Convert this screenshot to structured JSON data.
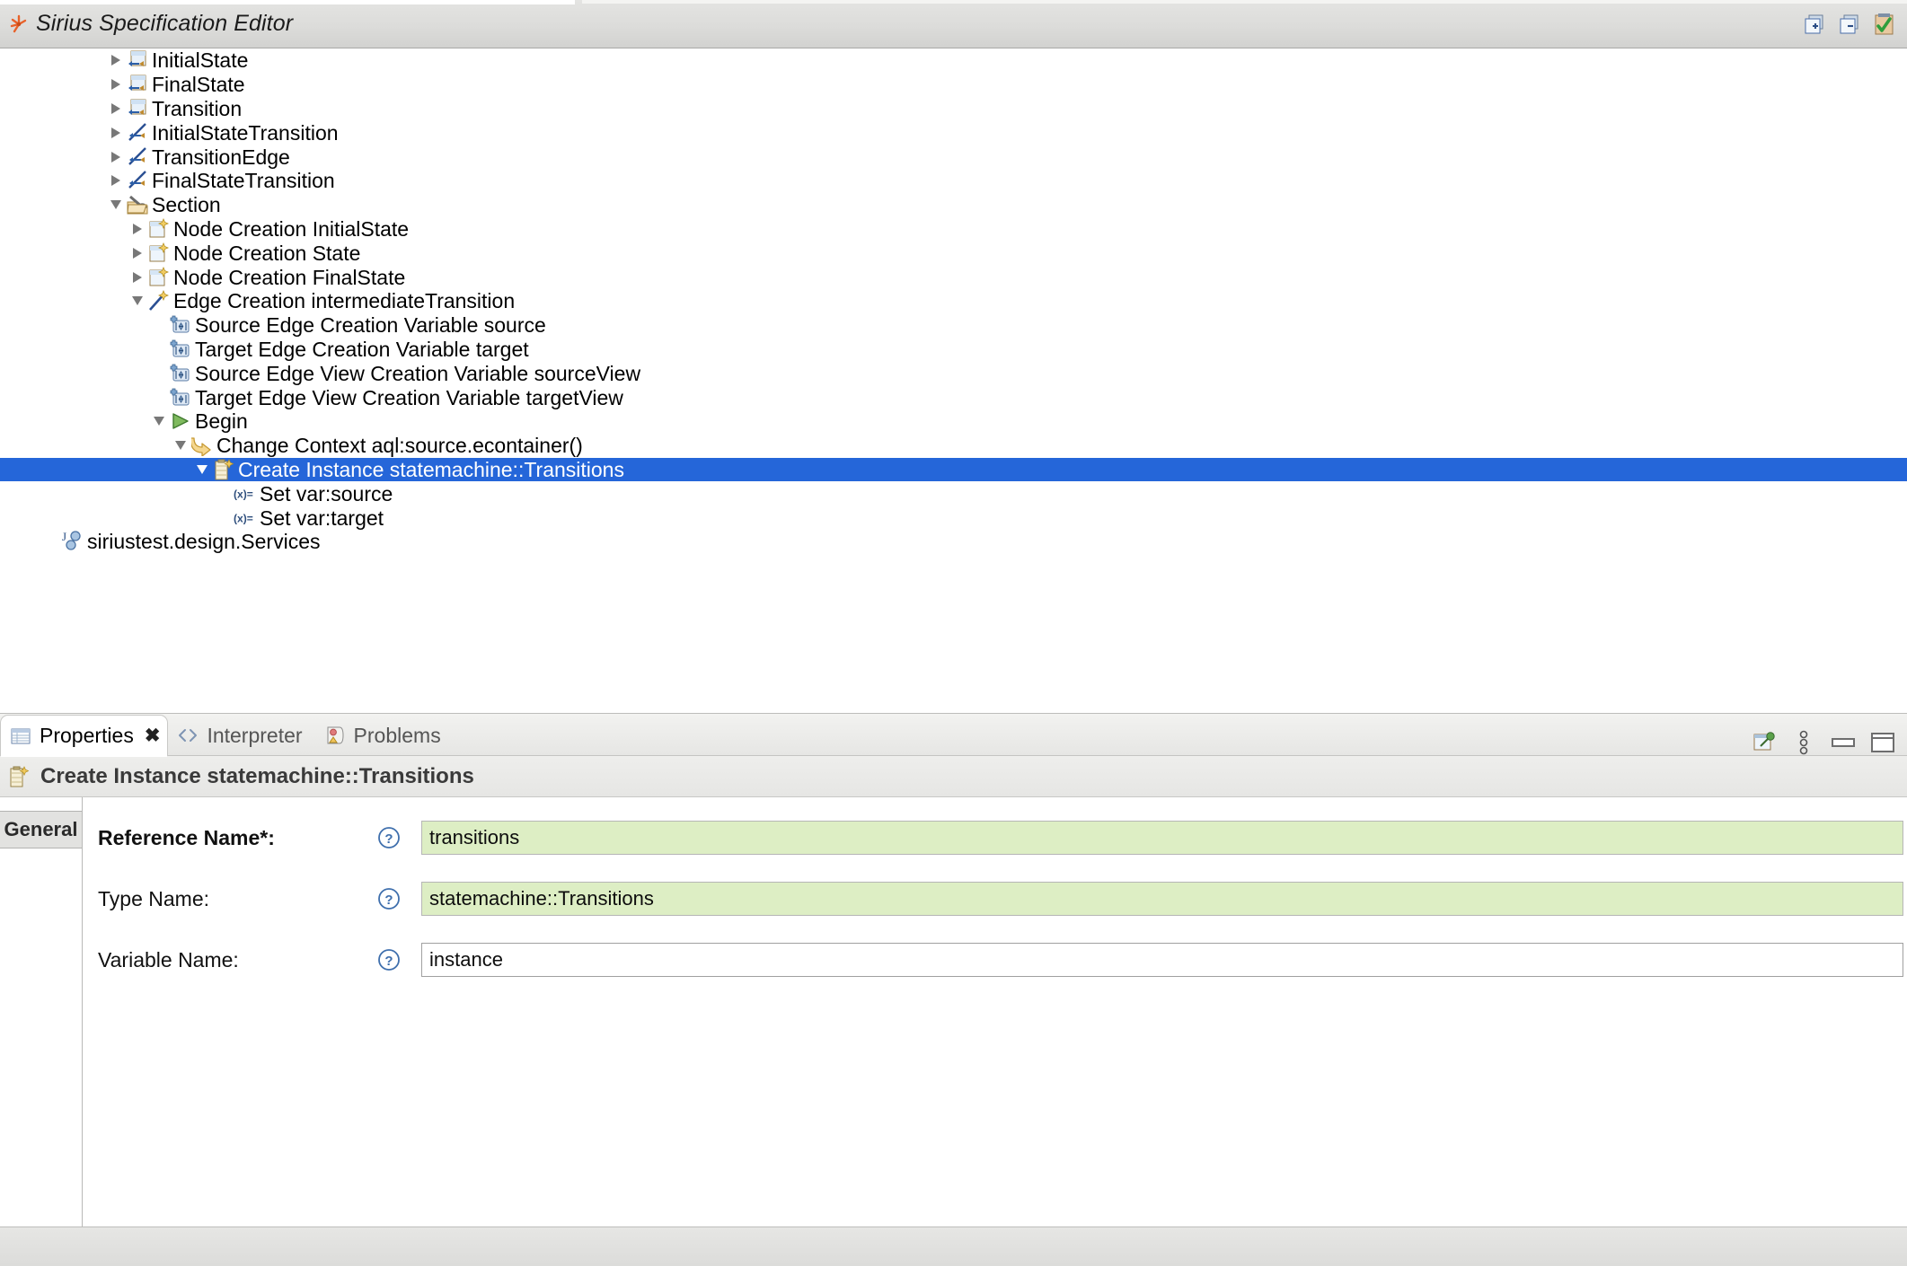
{
  "window": {
    "title": "Sirius Specification Editor",
    "icon": "sirius-icon",
    "controls": [
      {
        "name": "expand-all-button",
        "label": "Expand All"
      },
      {
        "name": "collapse-all-button",
        "label": "Collapse All"
      },
      {
        "name": "validate-button",
        "label": "Validate"
      }
    ]
  },
  "tree": {
    "rows": [
      {
        "label": "InitialState",
        "indent": 0,
        "toggle": "closed",
        "icon": "node-mapping-icon",
        "selected": false
      },
      {
        "label": "FinalState",
        "indent": 0,
        "toggle": "closed",
        "icon": "node-mapping-icon",
        "selected": false
      },
      {
        "label": "Transition",
        "indent": 0,
        "toggle": "closed",
        "icon": "node-mapping-icon",
        "selected": false
      },
      {
        "label": "InitialStateTransition",
        "indent": 0,
        "toggle": "closed",
        "icon": "edge-mapping-icon",
        "selected": false
      },
      {
        "label": "TransitionEdge",
        "indent": 0,
        "toggle": "closed",
        "icon": "edge-mapping-icon",
        "selected": false
      },
      {
        "label": "FinalStateTransition",
        "indent": 0,
        "toggle": "closed",
        "icon": "edge-mapping-icon",
        "selected": false
      },
      {
        "label": "Section",
        "indent": 0,
        "toggle": "open",
        "icon": "section-tools-icon",
        "selected": false
      },
      {
        "label": "Node Creation InitialState",
        "indent": 1,
        "toggle": "closed",
        "icon": "node-creation-icon",
        "selected": false
      },
      {
        "label": "Node Creation State",
        "indent": 1,
        "toggle": "closed",
        "icon": "node-creation-icon",
        "selected": false
      },
      {
        "label": "Node Creation FinalState",
        "indent": 1,
        "toggle": "closed",
        "icon": "node-creation-icon",
        "selected": false
      },
      {
        "label": "Edge Creation intermediateTransition",
        "indent": 1,
        "toggle": "open",
        "icon": "edge-creation-icon",
        "selected": false
      },
      {
        "label": "Source Edge Creation Variable source",
        "indent": 2,
        "toggle": "none",
        "icon": "variable-icon",
        "selected": false
      },
      {
        "label": "Target Edge Creation Variable target",
        "indent": 2,
        "toggle": "none",
        "icon": "variable-icon",
        "selected": false
      },
      {
        "label": "Source Edge View Creation Variable sourceView",
        "indent": 2,
        "toggle": "none",
        "icon": "variable-icon",
        "selected": false
      },
      {
        "label": "Target Edge View Creation Variable targetView",
        "indent": 2,
        "toggle": "none",
        "icon": "variable-icon",
        "selected": false
      },
      {
        "label": "Begin",
        "indent": 2,
        "toggle": "open",
        "icon": "begin-play-icon",
        "selected": false
      },
      {
        "label": "Change Context aql:source.econtainer()",
        "indent": 3,
        "toggle": "open",
        "icon": "change-context-icon",
        "selected": false
      },
      {
        "label": "Create Instance statemachine::Transitions",
        "indent": 4,
        "toggle": "open",
        "icon": "create-instance-icon",
        "selected": true
      },
      {
        "label": "Set var:source",
        "indent": 5,
        "toggle": "none",
        "icon": "set-value-icon",
        "selected": false
      },
      {
        "label": "Set var:target",
        "indent": 5,
        "toggle": "none",
        "icon": "set-value-icon",
        "selected": false
      },
      {
        "label": "siriustest.design.Services",
        "indent": -3,
        "toggle": "none",
        "icon": "java-services-icon",
        "selected": false
      }
    ]
  },
  "properties": {
    "tabs": [
      {
        "label": "Properties",
        "icon": "properties-icon",
        "active": true,
        "closable": true
      },
      {
        "label": "Interpreter",
        "icon": "interpreter-icon",
        "active": false,
        "closable": false
      },
      {
        "label": "Problems",
        "icon": "problems-icon",
        "active": false,
        "closable": false
      }
    ],
    "tools": [
      {
        "name": "pin-view-button",
        "label": "Pin this view"
      },
      {
        "name": "view-menu-button",
        "label": "View Menu"
      },
      {
        "name": "minimize-button",
        "label": "Minimize"
      },
      {
        "name": "maximize-button",
        "label": "Maximize"
      }
    ],
    "header": {
      "icon": "create-instance-icon",
      "title": "Create Instance statemachine::Transitions"
    },
    "side_tabs": [
      {
        "label": "General",
        "active": true
      }
    ],
    "fields": [
      {
        "label": "Reference Name*:",
        "required": true,
        "value": "transitions",
        "highlight": true,
        "help": "?"
      },
      {
        "label": "Type Name:",
        "required": false,
        "value": "statemachine::Transitions",
        "highlight": true,
        "help": "?"
      },
      {
        "label": "Variable Name:",
        "required": false,
        "value": "instance",
        "highlight": false,
        "help": "?"
      }
    ]
  },
  "colors": {
    "selection_blue": "#2566d9",
    "field_green": "#ddeec4",
    "chrome_gray": "#e4e4e2"
  }
}
